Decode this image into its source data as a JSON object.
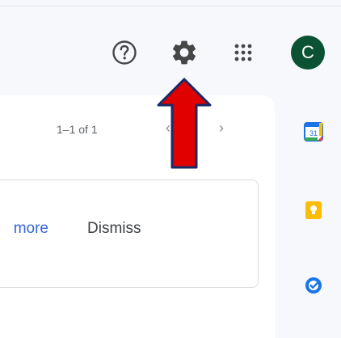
{
  "header": {
    "help_icon": "help-circle-icon",
    "settings_icon": "gear-icon",
    "apps_icon": "apps-grid-icon",
    "avatar_letter": "C",
    "avatar_color": "#0b5234"
  },
  "main": {
    "pager": {
      "range_text": "1–1 of 1",
      "prev_icon": "chevron-left-icon",
      "next_icon": "chevron-right-icon"
    },
    "notice": {
      "learn_more_label": "more",
      "dismiss_label": "Dismiss"
    }
  },
  "side_panel": {
    "calendar_label": "31",
    "icons": [
      "calendar-icon",
      "keep-icon",
      "tasks-icon"
    ]
  },
  "annotation": {
    "arrow_color": "#e00000",
    "target": "settings"
  }
}
